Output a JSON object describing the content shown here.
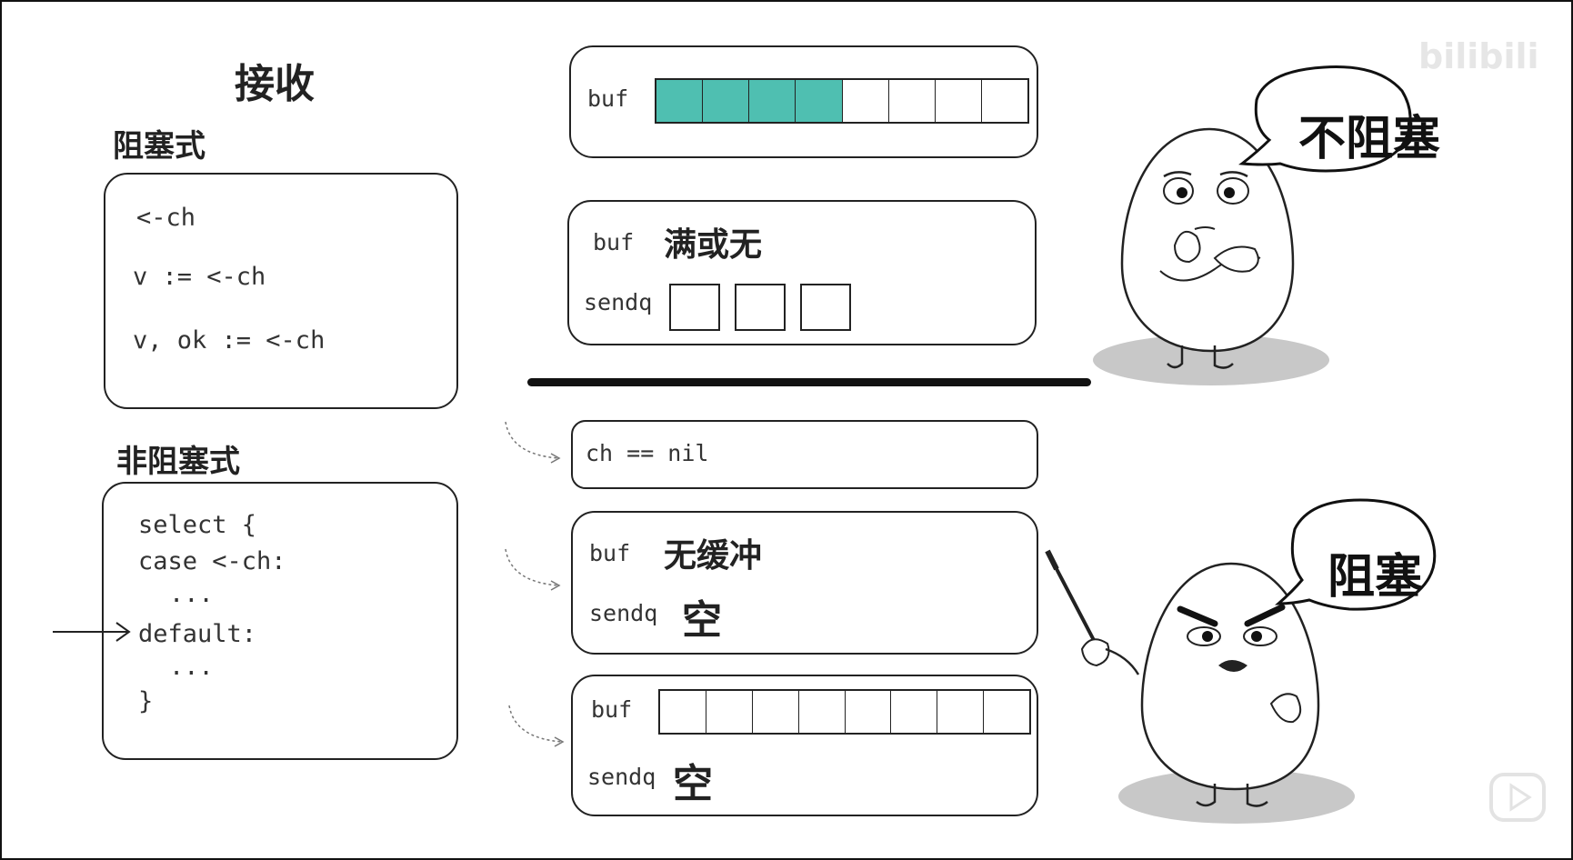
{
  "left": {
    "title": "接收",
    "blocking": {
      "heading": "阻塞式",
      "lines": [
        "<-ch",
        "v := <-ch",
        "v, ok := <-ch"
      ]
    },
    "nonblocking": {
      "heading": "非阻塞式",
      "lines": [
        "select {",
        "case <-ch:",
        "...",
        "default:",
        "...",
        "}"
      ]
    }
  },
  "right": {
    "case1": {
      "buf_label": "buf",
      "slots_total": 8,
      "slots_filled": 4
    },
    "case2": {
      "buf_label": "buf",
      "buf_note": "满或无",
      "sendq_label": "sendq",
      "sendq_slots": 3
    },
    "case3": {
      "text": "ch == nil"
    },
    "case4": {
      "buf_label": "buf",
      "buf_note": "无缓冲",
      "sendq_label": "sendq",
      "sendq_note": "空"
    },
    "case5": {
      "buf_label": "buf",
      "slots_total": 8,
      "slots_filled": 0,
      "sendq_label": "sendq",
      "sendq_note": "空"
    }
  },
  "bubbles": {
    "top": "不阻塞",
    "bottom": "阻塞"
  },
  "watermark": "bilibili",
  "colors": {
    "filled_slot": "#4fbfb1",
    "shadow": "#c8c8c8"
  }
}
